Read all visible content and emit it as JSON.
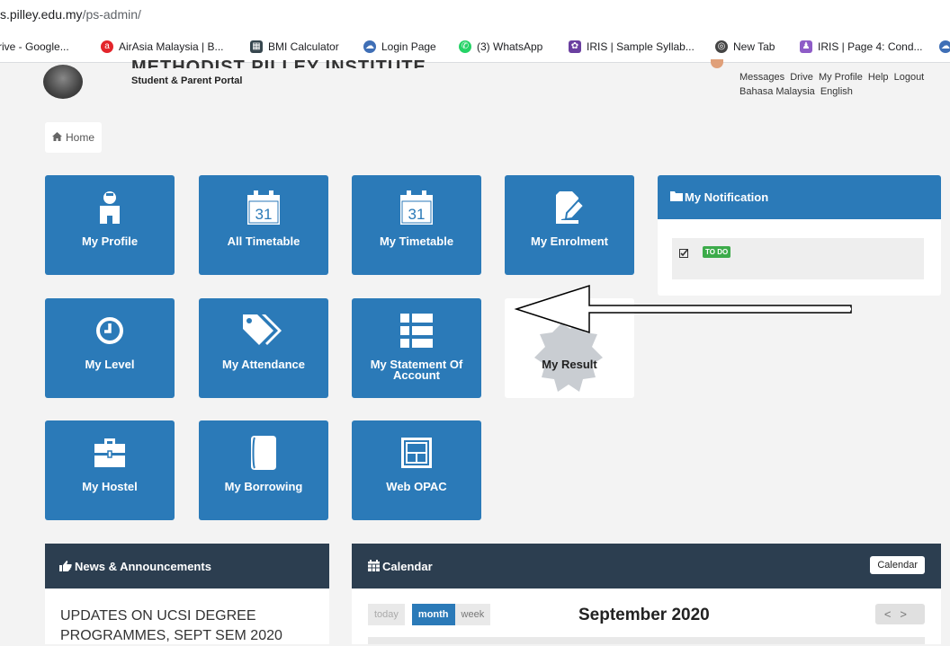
{
  "browser": {
    "url_prefix": "s.pilley.edu.my",
    "url_path": "/ps-admin/",
    "bookmarks": [
      {
        "label": "rive - Google...",
        "icon": "drive-icon",
        "color": "#1a73e8"
      },
      {
        "label": "AirAsia Malaysia | B...",
        "icon": "airasia-icon",
        "color": "#e3252b"
      },
      {
        "label": "BMI Calculator",
        "icon": "calculator-icon",
        "color": "#37474f"
      },
      {
        "label": "Login Page",
        "icon": "login-icon",
        "color": "#3f6fb6"
      },
      {
        "label": "(3) WhatsApp",
        "icon": "whatsapp-icon",
        "color": "#25d366"
      },
      {
        "label": "IRIS | Sample Syllab...",
        "icon": "iris-icon",
        "color": "#6a3fa0"
      },
      {
        "label": "New Tab",
        "icon": "globe-icon",
        "color": "#444444"
      },
      {
        "label": "IRIS | Page 4: Cond...",
        "icon": "iris-icon",
        "color": "#8e5cc7"
      }
    ]
  },
  "header": {
    "institute": "METHODIST PILLEY INSTITUTE",
    "subtitle": "Student & Parent Portal",
    "nav_top": [
      "Messages",
      "Drive",
      "My Profile",
      "Help",
      "Logout"
    ],
    "nav_lang": [
      "Bahasa Malaysia",
      "English"
    ]
  },
  "breadcrumb": {
    "home": "Home"
  },
  "tiles": [
    {
      "label": "My Profile",
      "icon": "user-icon"
    },
    {
      "label": "All Timetable",
      "icon": "calendar-icon",
      "day": "31"
    },
    {
      "label": "My Timetable",
      "icon": "calendar-icon",
      "day": "31"
    },
    {
      "label": "My Enrolment",
      "icon": "edit-icon"
    },
    {
      "label": "My Level",
      "icon": "clock-icon"
    },
    {
      "label": "My Attendance",
      "icon": "tag-icon"
    },
    {
      "label": "My Statement Of Account",
      "icon": "list-icon"
    },
    {
      "label": "My Result",
      "icon": "badge-icon"
    },
    {
      "label": "My Hostel",
      "icon": "briefcase-icon"
    },
    {
      "label": "My Borrowing",
      "icon": "book-icon"
    },
    {
      "label": "Web OPAC",
      "icon": "window-icon"
    }
  ],
  "notification": {
    "title": "My Notification",
    "badge": "TO DO"
  },
  "news": {
    "title": "News & Announcements",
    "headline": "UPDATES ON UCSI DEGREE PROGRAMMES, SEPT SEM 2020"
  },
  "calendar": {
    "title": "Calendar",
    "button": "Calendar",
    "today": "today",
    "month": "month",
    "week": "week",
    "current": "September 2020",
    "prev": "<",
    "next": ">"
  },
  "colors": {
    "tile_blue": "#2b7ab8",
    "panel_dark": "#2c3e50",
    "todo_green": "#3cab4a"
  }
}
